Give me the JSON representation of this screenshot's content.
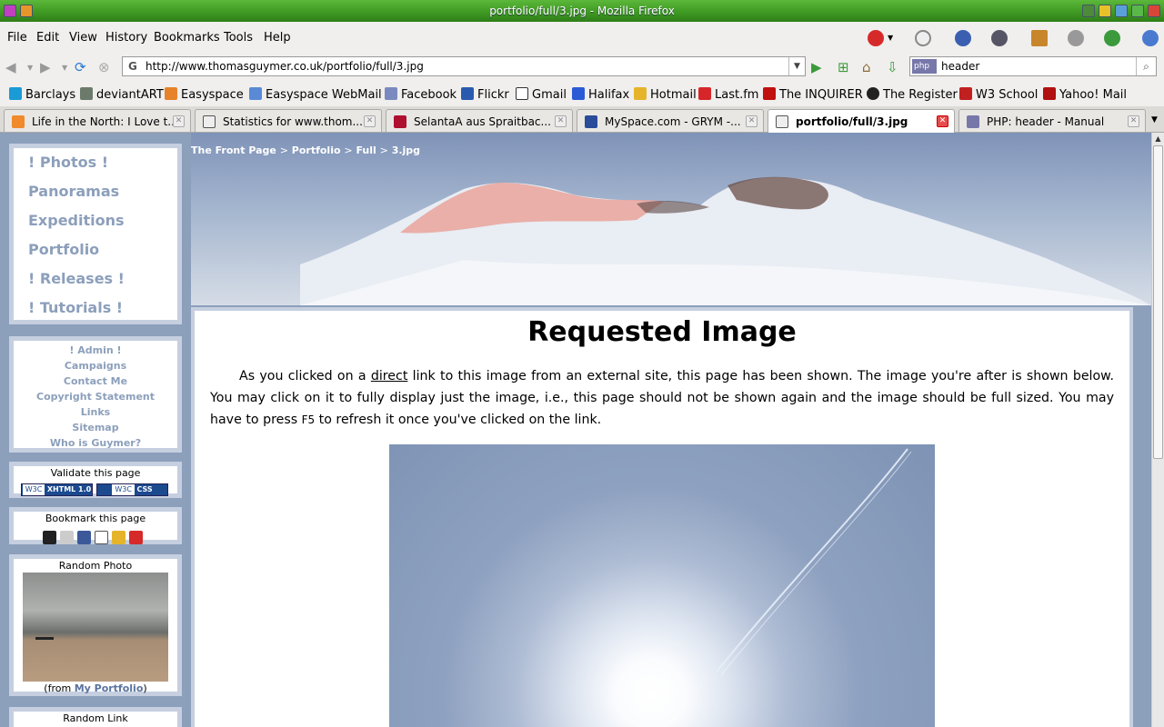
{
  "window": {
    "title": "portfolio/full/3.jpg - Mozilla Firefox"
  },
  "menu": [
    "File",
    "Edit",
    "View",
    "History",
    "Bookmarks",
    "Tools",
    "Help"
  ],
  "navigation": {
    "url": "http://www.thomasguymer.co.uk/portfolio/full/3.jpg",
    "search_engine": "php",
    "search_value": "header"
  },
  "bookmarks": [
    "Barclays",
    "deviantART",
    "Easyspace",
    "Easyspace WebMail",
    "Facebook",
    "Flickr",
    "Gmail",
    "Halifax",
    "Hotmail",
    "Last.fm",
    "The INQUIRER",
    "The Register",
    "W3 School",
    "Yahoo! Mail"
  ],
  "tabs": [
    {
      "label": "Life in the North: I Love t...",
      "active": false
    },
    {
      "label": "Statistics for www.thom...",
      "active": false
    },
    {
      "label": "SelantaA aus Spraitbac...",
      "active": false
    },
    {
      "label": "MySpace.com - GRYM -...",
      "active": false
    },
    {
      "label": "portfolio/full/3.jpg",
      "active": true
    },
    {
      "label": "PHP: header - Manual",
      "active": false
    }
  ],
  "sidebar": {
    "nav": [
      "! Photos !",
      "Panoramas",
      "Expeditions",
      "Portfolio",
      "! Releases !",
      "! Tutorials !"
    ],
    "links": [
      "! Admin !",
      "Campaigns",
      "Contact Me",
      "Copyright Statement",
      "Links",
      "Sitemap",
      "Who is Guymer?"
    ],
    "validate_title": "Validate this page",
    "validate_badges": [
      {
        "w3c": "W3C",
        "label": "XHTML 1.0"
      },
      {
        "w3c": "W3C",
        "label": "CSS"
      }
    ],
    "bookmark_title": "Bookmark this page",
    "random_photo_title": "Random Photo",
    "random_photo_caption_prefix": "(from ",
    "random_photo_caption_link": "My Portfolio",
    "random_photo_caption_suffix": ")",
    "random_link_title": "Random Link"
  },
  "breadcrumb": [
    "The Front Page",
    "Portfolio",
    "Full",
    "3.jpg"
  ],
  "breadcrumb_sep": ">",
  "main": {
    "heading": "Requested Image",
    "intro_1": "As you clicked on a ",
    "intro_link": "direct",
    "intro_2": " link to this image from an external site, this page has been shown. The image you're after is shown below. You may click on it to fully display just the image, i.e., this page should not be shown again and the image should be full sized. You may have to press ",
    "intro_key": "F5",
    "intro_3": " to refresh it once you've clicked on the link."
  },
  "colors": {
    "titlebar": "#3f9a22",
    "page_bg": "#8c9fbb",
    "link": "#8c9fbb",
    "panel_border": "#c5cfe0",
    "active_tab_close": "#e84c4c"
  }
}
